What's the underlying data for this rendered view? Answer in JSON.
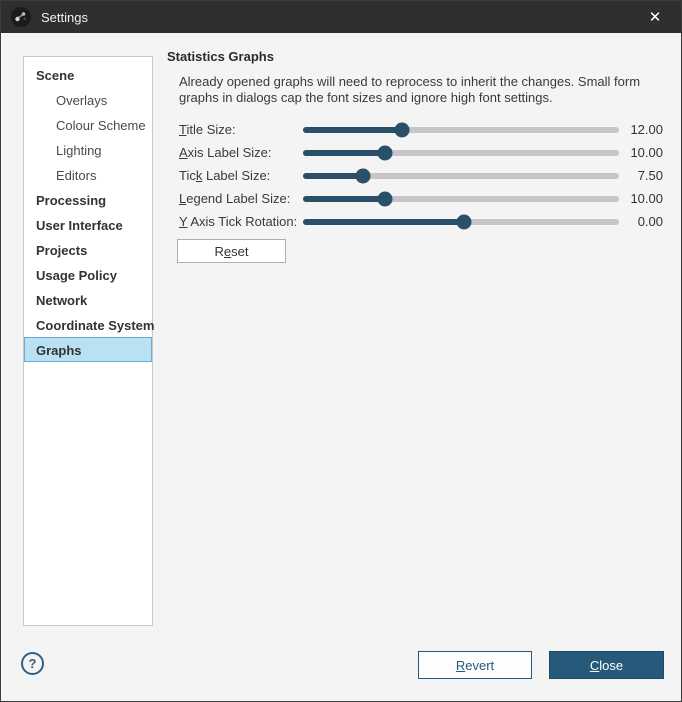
{
  "window": {
    "title": "Settings",
    "close_icon": "✕"
  },
  "sidebar": {
    "items": [
      {
        "label": "Scene",
        "level": 0,
        "selected": false
      },
      {
        "label": "Overlays",
        "level": 1,
        "selected": false
      },
      {
        "label": "Colour Scheme",
        "level": 1,
        "selected": false
      },
      {
        "label": "Lighting",
        "level": 1,
        "selected": false
      },
      {
        "label": "Editors",
        "level": 1,
        "selected": false
      },
      {
        "label": "Processing",
        "level": 0,
        "selected": false
      },
      {
        "label": "User Interface",
        "level": 0,
        "selected": false
      },
      {
        "label": "Projects",
        "level": 0,
        "selected": false
      },
      {
        "label": "Usage Policy",
        "level": 0,
        "selected": false
      },
      {
        "label": "Network",
        "level": 0,
        "selected": false
      },
      {
        "label": "Coordinate System",
        "level": 0,
        "selected": false
      },
      {
        "label": "Graphs",
        "level": 0,
        "selected": true
      }
    ]
  },
  "content": {
    "heading": "Statistics Graphs",
    "description": "Already opened graphs will need to reprocess to inherit the changes. Small form graphs in dialogs cap the font sizes and ignore high font settings.",
    "sliders": [
      {
        "label_pre": "",
        "label_key": "T",
        "label_post": "itle Size:",
        "value": "12.00",
        "percent": 31.4
      },
      {
        "label_pre": "",
        "label_key": "A",
        "label_post": "xis Label Size:",
        "value": "10.00",
        "percent": 25.8
      },
      {
        "label_pre": "Tic",
        "label_key": "k",
        "label_post": " Label Size:",
        "value": "7.50",
        "percent": 18.9
      },
      {
        "label_pre": "",
        "label_key": "L",
        "label_post": "egend Label Size:",
        "value": "10.00",
        "percent": 25.8
      },
      {
        "label_pre": "",
        "label_key": "Y",
        "label_post": " Axis Tick Rotation:",
        "value": "0.00",
        "percent": 50.9
      }
    ],
    "reset_button": {
      "pre": "R",
      "key": "e",
      "post": "set"
    }
  },
  "footer": {
    "help_icon": "?",
    "revert_button": {
      "pre": "",
      "key": "R",
      "post": "evert"
    },
    "close_button": {
      "pre": "",
      "key": "C",
      "post": "lose"
    }
  },
  "colors": {
    "accent_navy": "#2a4f69",
    "close_button_bg": "#26597a",
    "selected_item_bg": "#b9e1f3",
    "titlebar_bg": "#2f2f2f"
  }
}
